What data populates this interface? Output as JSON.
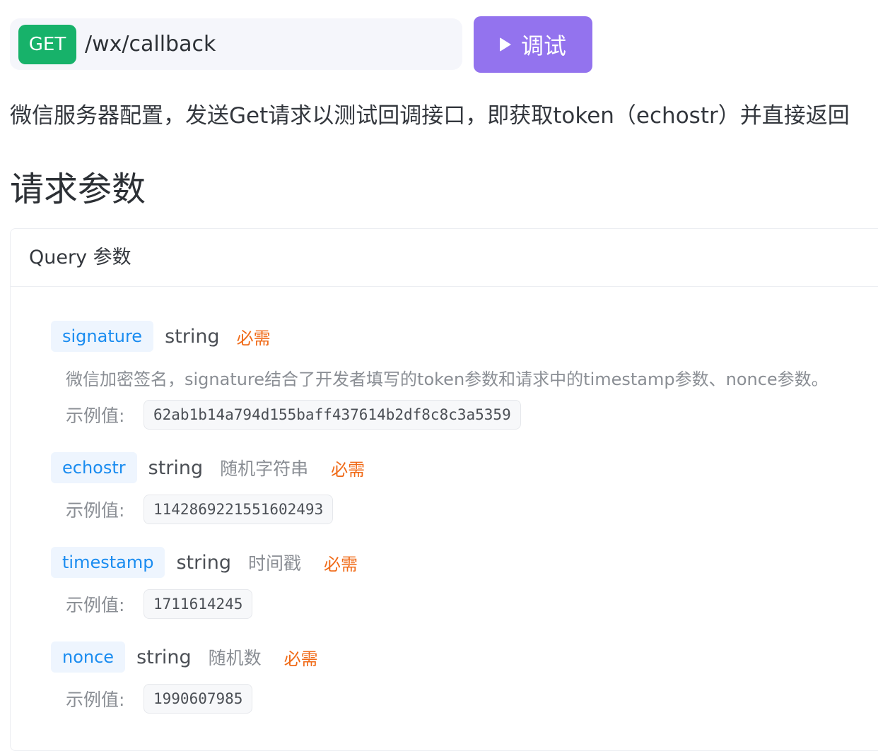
{
  "request": {
    "method": "GET",
    "path": "/wx/callback",
    "debug_label": "调试"
  },
  "description": "微信服务器配置，发送Get请求以测试回调接口，即获取token（echostr）并直接返回",
  "section_title": "请求参数",
  "query_card": {
    "title": "Query 参数",
    "example_label": "示例值:",
    "params": [
      {
        "name": "signature",
        "type": "string",
        "short_desc": "",
        "required": "必需",
        "long_desc": "微信加密签名，signature结合了开发者填写的token参数和请求中的timestamp参数、nonce参数。",
        "example": "62ab1b14a794d155baff437614b2df8c8c3a5359"
      },
      {
        "name": "echostr",
        "type": "string",
        "short_desc": "随机字符串",
        "required": "必需",
        "long_desc": "",
        "example": "1142869221551602493"
      },
      {
        "name": "timestamp",
        "type": "string",
        "short_desc": "时间戳",
        "required": "必需",
        "long_desc": "",
        "example": "1711614245"
      },
      {
        "name": "nonce",
        "type": "string",
        "short_desc": "随机数",
        "required": "必需",
        "long_desc": "",
        "example": "1990607985"
      }
    ]
  },
  "colors": {
    "get_badge": "#17b26a",
    "debug_button": "#9373ee",
    "param_name": "#1a8cf0",
    "required": "#f06a17"
  }
}
